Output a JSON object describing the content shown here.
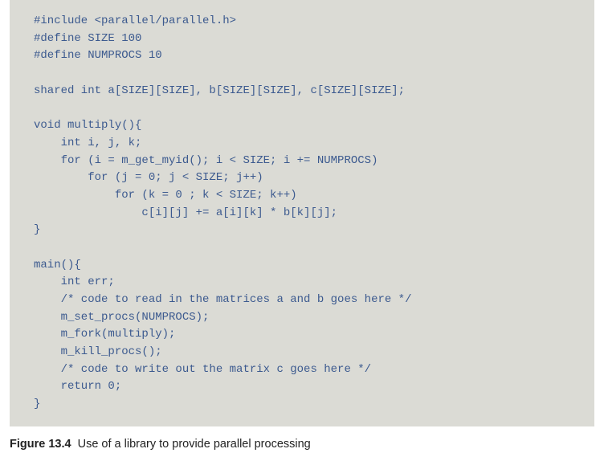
{
  "code": {
    "lines": [
      "#include <parallel/parallel.h>",
      "#define SIZE 100",
      "#define NUMPROCS 10",
      "",
      "shared int a[SIZE][SIZE], b[SIZE][SIZE], c[SIZE][SIZE];",
      "",
      "void multiply(){",
      "    int i, j, k;",
      "    for (i = m_get_myid(); i < SIZE; i += NUMPROCS)",
      "        for (j = 0; j < SIZE; j++)",
      "            for (k = 0 ; k < SIZE; k++)",
      "                c[i][j] += a[i][k] * b[k][j];",
      "}",
      "",
      "main(){",
      "    int err;",
      "    /* code to read in the matrices a and b goes here */",
      "    m_set_procs(NUMPROCS);",
      "    m_fork(multiply);",
      "    m_kill_procs();",
      "    /* code to write out the matrix c goes here */",
      "    return 0;",
      "}"
    ]
  },
  "caption": {
    "label": "Figure 13.4",
    "text": "Use of a library to provide parallel processing"
  }
}
